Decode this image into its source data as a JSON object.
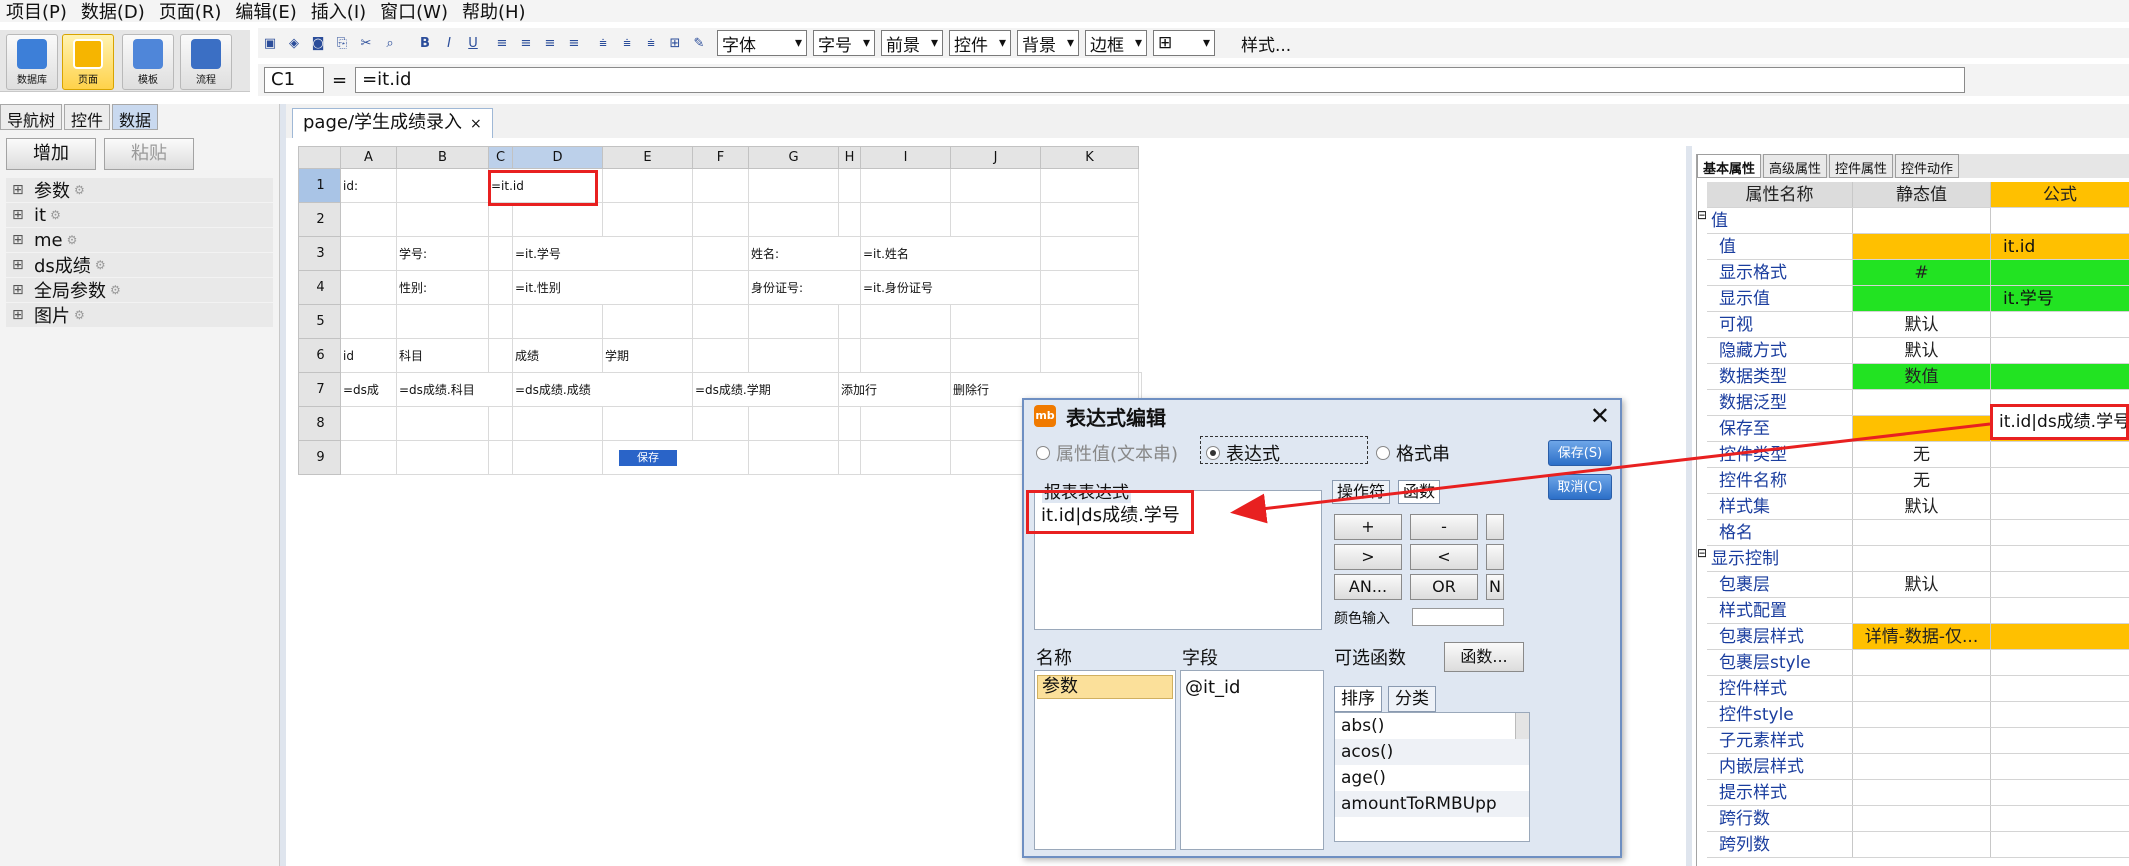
{
  "menu": [
    "项目(P)",
    "数据(D)",
    "页面(R)",
    "编辑(E)",
    "插入(I)",
    "窗口(W)",
    "帮助(H)"
  ],
  "big_tools": [
    {
      "label": "数据库",
      "icon": "database-icon"
    },
    {
      "label": "页面",
      "icon": "page-icon"
    },
    {
      "label": "模板",
      "icon": "template-icon"
    },
    {
      "label": "流程",
      "icon": "flow-icon"
    }
  ],
  "format_bar": {
    "font": "字体",
    "size": "字号",
    "fore": "前景",
    "control": "控件",
    "back": "背景",
    "border": "边框",
    "style": "样式..."
  },
  "formula": {
    "cell_ref": "C1",
    "eq": "=",
    "value": "=it.id"
  },
  "left_panel": {
    "tabs": [
      "导航树",
      "控件",
      "数据"
    ],
    "add": "增加",
    "paste": "粘贴",
    "tree": [
      "参数",
      "it",
      "me",
      "ds成绩",
      "全局参数",
      "图片"
    ]
  },
  "doc_tab": {
    "title": "page/学生成绩录入",
    "close": "×"
  },
  "sheet": {
    "cols": [
      "A",
      "B",
      "C",
      "D",
      "E",
      "F",
      "G",
      "H",
      "I",
      "J",
      "K"
    ],
    "rows": [
      "1",
      "2",
      "3",
      "4",
      "5",
      "6",
      "7",
      "8",
      "9"
    ],
    "cells": {
      "r1a": "id:",
      "r1d": "=it.id",
      "r3b": "学号:",
      "r3d": "=it.学号",
      "r3g": "姓名:",
      "r3i": "=it.姓名",
      "r4b": "性别:",
      "r4d": "=it.性别",
      "r4g": "身份证号:",
      "r4i": "=it.身份证号",
      "r6a": "id",
      "r6b": "科目",
      "r6d": "成绩",
      "r6e": "学期",
      "r7a": "=ds成",
      "r7b": "=ds成绩.科目",
      "r7d": "=ds成绩.成绩",
      "r7e": "=ds成绩.学期",
      "r7g": "添加行",
      "r7h": "删除行",
      "r9e": "保存"
    }
  },
  "props": {
    "tabs": [
      "基本属性",
      "高级属性",
      "控件属性",
      "控件动作"
    ],
    "headers": [
      "属性名称",
      "静态值",
      "公式"
    ],
    "rows": [
      {
        "name": "值",
        "group": true
      },
      {
        "name": "值",
        "static": "",
        "formula": "it.id",
        "c2": "y",
        "c3": "y"
      },
      {
        "name": "显示格式",
        "static": "#",
        "formula": "",
        "c2": "g",
        "c3": "g"
      },
      {
        "name": "显示值",
        "static": "",
        "formula": "it.学号",
        "c2": "g",
        "c3": "g"
      },
      {
        "name": "可视",
        "static": "默认",
        "formula": ""
      },
      {
        "name": "隐藏方式",
        "static": "默认",
        "formula": ""
      },
      {
        "name": "数据类型",
        "static": "数值",
        "formula": "",
        "c2": "g",
        "c3": "g"
      },
      {
        "name": "数据泛型",
        "static": "",
        "formula": ""
      },
      {
        "name": "保存至",
        "static": "",
        "formula": "",
        "c2": "y",
        "c3": "y"
      },
      {
        "name": "控件类型",
        "static": "无",
        "formula": ""
      },
      {
        "name": "控件名称",
        "static": "无",
        "formula": ""
      },
      {
        "name": "样式集",
        "static": "默认",
        "formula": ""
      },
      {
        "name": "格名",
        "static": "",
        "formula": ""
      },
      {
        "name": "显示控制",
        "group": true
      },
      {
        "name": "包裹层",
        "static": "默认",
        "formula": ""
      },
      {
        "name": "样式配置",
        "static": "",
        "formula": ""
      },
      {
        "name": "包裹层样式",
        "static": "详情-数据-仅...",
        "formula": "",
        "c2": "y",
        "c3": "y"
      },
      {
        "name": "包裹层style",
        "static": "",
        "formula": ""
      },
      {
        "name": "控件样式",
        "static": "",
        "formula": ""
      },
      {
        "name": "控件style",
        "static": "",
        "formula": ""
      },
      {
        "name": "子元素样式",
        "static": "",
        "formula": ""
      },
      {
        "name": "内嵌层样式",
        "static": "",
        "formula": ""
      },
      {
        "name": "提示样式",
        "static": "",
        "formula": ""
      },
      {
        "name": "跨行数",
        "static": "",
        "formula": ""
      },
      {
        "name": "跨列数",
        "static": "",
        "formula": ""
      }
    ],
    "callout": "it.id|ds成绩.学号"
  },
  "dialog": {
    "title": "表达式编辑",
    "logo": "mb",
    "close": "✕",
    "radio1": "属性值(文本串)",
    "radio2": "表达式",
    "radio3": "格式串",
    "save": "保存(S)",
    "cancel": "取消(C)",
    "expr_label": "报表表达式",
    "expr_value": "it.id|ds成绩.学号",
    "op_tab1": "操作符",
    "op_tab2": "函数",
    "ops": [
      "+",
      "-",
      ">",
      "<",
      "AN...",
      "OR",
      "N"
    ],
    "color_input": "颜色输入",
    "name_hdr": "名称",
    "field_hdr": "字段",
    "func_hdr": "可选函数",
    "func_btn": "函数...",
    "name_item": "参数",
    "field_item": "@it_id",
    "func_tab1": "排序",
    "func_tab2": "分类",
    "funcs": [
      "abs()",
      "acos()",
      "age()",
      "amountToRMBUpp"
    ]
  }
}
